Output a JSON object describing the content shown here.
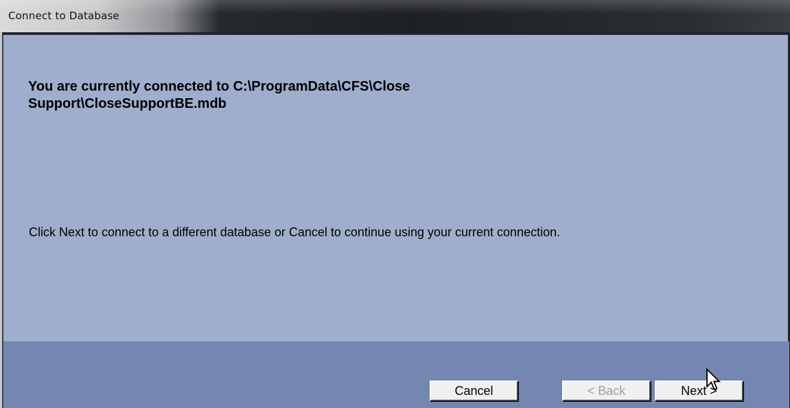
{
  "window": {
    "title": "Connect to Database"
  },
  "content": {
    "connection_message": "You are currently connected to C:\\ProgramData\\CFS\\Close Support\\CloseSupportBE.mdb",
    "instructions": "Click Next to connect to a different database or Cancel to continue using your current connection."
  },
  "buttons": {
    "cancel_label": "Cancel",
    "back_label": "< Back",
    "next_label": "Next >",
    "back_enabled": false
  },
  "colors": {
    "content_bg": "#a0aecd",
    "footer_bg": "#7387b0",
    "titlebar_dark": "#1e2124"
  },
  "icons": {
    "cursor": "arrow-cursor-icon"
  }
}
